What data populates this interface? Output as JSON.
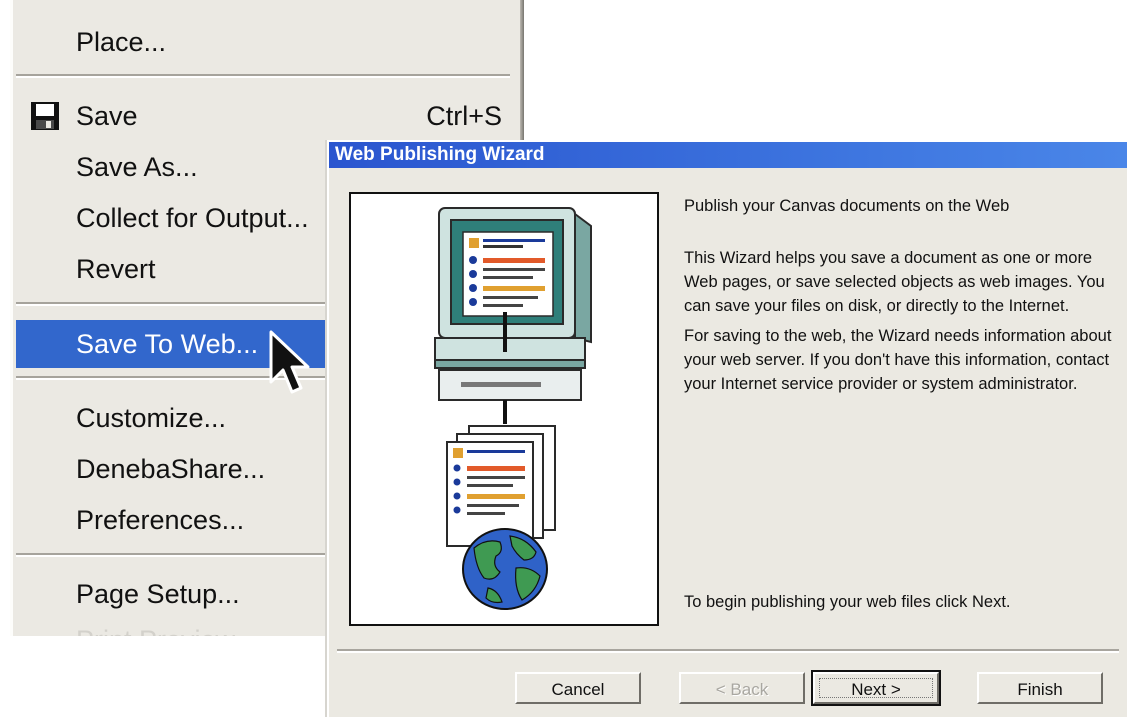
{
  "menu": {
    "items": [
      {
        "label": "Place...",
        "shortcut": ""
      },
      {
        "label": "Save",
        "shortcut": "Ctrl+S",
        "icon": "floppy-disk-icon"
      },
      {
        "label": "Save As...",
        "shortcut": ""
      },
      {
        "label": "Collect for Output...",
        "shortcut": ""
      },
      {
        "label": "Revert",
        "shortcut": ""
      },
      {
        "label": "Save To Web...",
        "shortcut": ""
      },
      {
        "label": "Customize...",
        "shortcut": ""
      },
      {
        "label": "DenebaShare...",
        "shortcut": ""
      },
      {
        "label": "Preferences...",
        "shortcut": ""
      },
      {
        "label": "Page Setup...",
        "shortcut": ""
      },
      {
        "label": "Print Preview...",
        "shortcut": ""
      }
    ],
    "selected_item": "Save To Web...",
    "highlight_color": "#3267cc"
  },
  "wizard": {
    "title": "Web Publishing Wizard",
    "heading": "Publish your Canvas documents on the Web",
    "paragraphs": [
      "This Wizard helps you save a document as one or more Web pages, or save selected objects as web images. You can save your files on disk, or directly to the Internet.",
      "For saving to the web, the Wizard needs information about your web server. If you don't have this information, contact your Internet service provider or system administrator."
    ],
    "footer_text": "To begin publishing your web files click Next.",
    "illustration": [
      "computer-monitor-icon",
      "document-page-icon",
      "down-arrow-icon",
      "globe-icon"
    ],
    "buttons": {
      "cancel": "Cancel",
      "back": "< Back",
      "next": "Next >",
      "finish": "Finish"
    },
    "title_bar_color": "#2a55cf"
  }
}
